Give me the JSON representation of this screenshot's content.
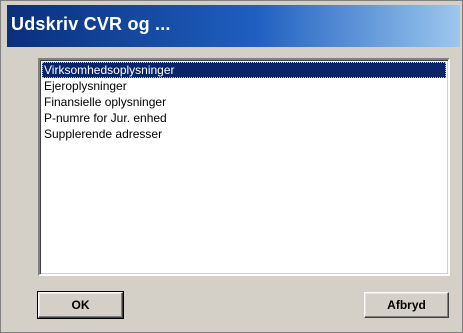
{
  "window": {
    "title": "Udskriv CVR og ..."
  },
  "list": {
    "items": [
      {
        "label": "Virksomhedsoplysninger",
        "selected": true
      },
      {
        "label": "Ejeroplysninger",
        "selected": false
      },
      {
        "label": "Finansielle oplysninger",
        "selected": false
      },
      {
        "label": "P-numre for Jur. enhed",
        "selected": false
      },
      {
        "label": "Supplerende adresser",
        "selected": false
      }
    ]
  },
  "buttons": {
    "ok_label": "OK",
    "cancel_label": "Afbryd"
  },
  "colors": {
    "title_gradient_start": "#0a2f7c",
    "title_gradient_end": "#9cc8ee",
    "selection": "#0a246a",
    "dialog_face": "#d4d0c8"
  }
}
